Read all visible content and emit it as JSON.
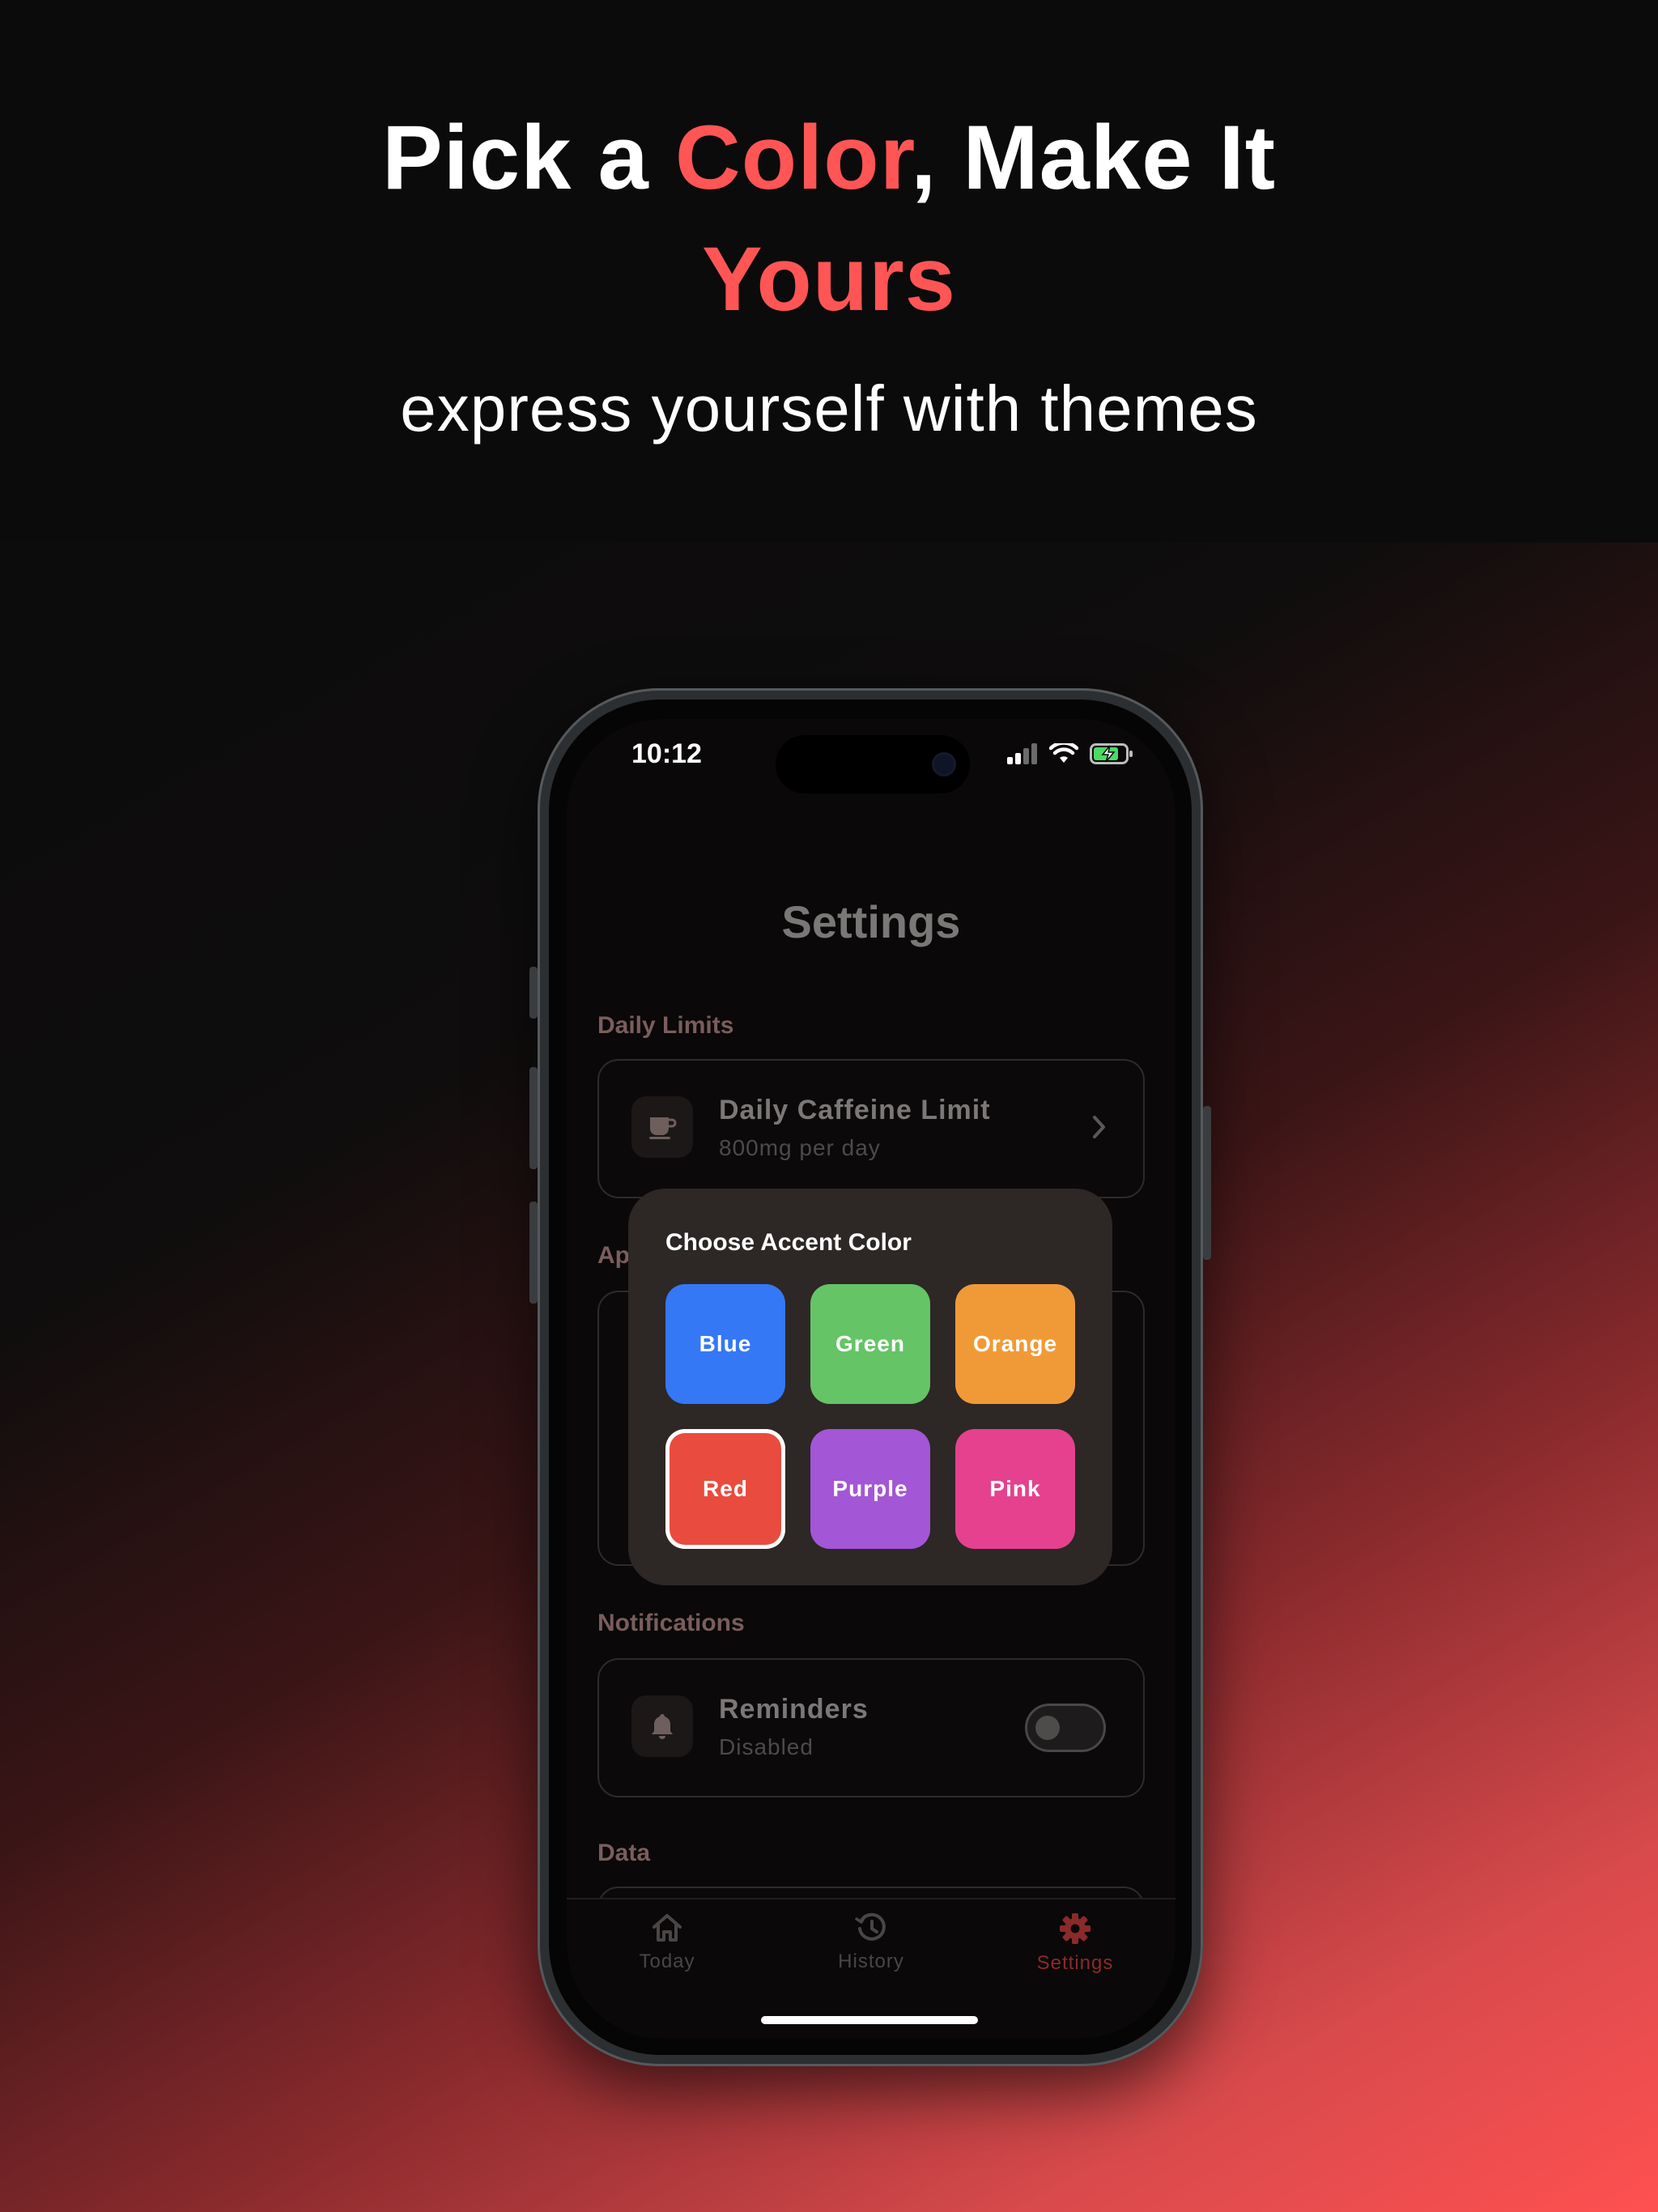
{
  "headline": {
    "part1": "Pick a ",
    "accent1": "Color",
    "part2": ", Make It",
    "accent2": "Yours"
  },
  "subhead": "express yourself with themes",
  "colors": {
    "accent": "#ff5555",
    "background": "#0b0b0b"
  },
  "status_bar": {
    "time": "10:12",
    "icons": [
      "signal-icon",
      "wifi-icon",
      "battery-charging-icon"
    ]
  },
  "screen": {
    "title": "Settings",
    "sections": {
      "daily_limits": {
        "label": "Daily Limits",
        "row": {
          "icon": "coffee-icon",
          "title": "Daily Caffeine Limit",
          "subtitle": "800mg per day"
        }
      },
      "appearance": {
        "label": "Ap"
      },
      "notifications": {
        "label": "Notifications",
        "row": {
          "icon": "bell-icon",
          "title": "Reminders",
          "subtitle": "Disabled",
          "toggle_on": false
        }
      },
      "data": {
        "label": "Data"
      }
    },
    "accent_popup": {
      "title": "Choose Accent Color",
      "options": [
        {
          "label": "Blue",
          "color": "#3478f6",
          "selected": false
        },
        {
          "label": "Green",
          "color": "#65c466",
          "selected": false
        },
        {
          "label": "Orange",
          "color": "#f09a37",
          "selected": false
        },
        {
          "label": "Red",
          "color": "#e94b3f",
          "selected": true
        },
        {
          "label": "Purple",
          "color": "#a356d6",
          "selected": false
        },
        {
          "label": "Pink",
          "color": "#e5418e",
          "selected": false
        }
      ]
    },
    "tabs": [
      {
        "label": "Today",
        "icon": "home-icon",
        "active": false
      },
      {
        "label": "History",
        "icon": "history-icon",
        "active": false
      },
      {
        "label": "Settings",
        "icon": "gear-icon",
        "active": true
      }
    ]
  }
}
